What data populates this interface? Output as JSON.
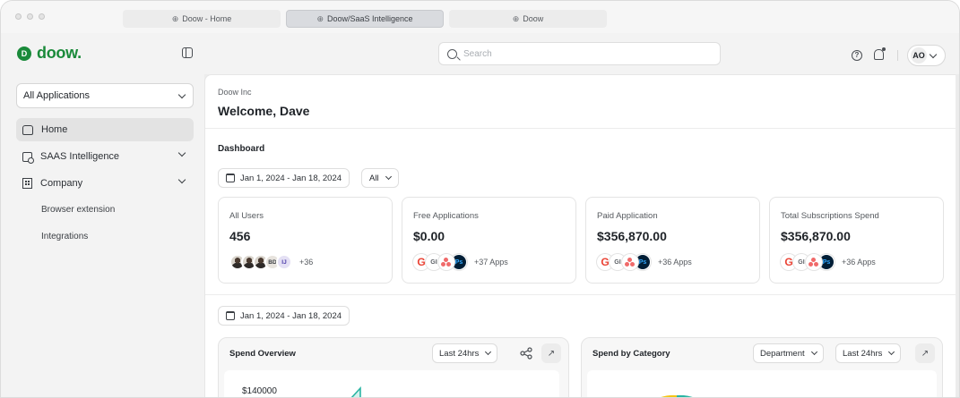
{
  "browser": {
    "tabs": [
      {
        "label": "Doow - Home"
      },
      {
        "label": "Doow/SaaS Intelligence"
      },
      {
        "label": "Doow"
      }
    ]
  },
  "header": {
    "brand": "doow.",
    "brand_mark": "D",
    "search_placeholder": "Search",
    "user_initials": "AO"
  },
  "sidebar": {
    "app_selector": "All Applications",
    "items": [
      {
        "label": "Home",
        "icon": "home-icon"
      },
      {
        "label": "SAAS Intelligence",
        "icon": "saas-icon"
      },
      {
        "label": "Company",
        "icon": "company-icon"
      }
    ],
    "sub_items": [
      "Browser extension",
      "Integrations"
    ]
  },
  "main": {
    "org_name": "Doow Inc",
    "welcome": "Welcome, Dave",
    "section_title": "Dashboard",
    "date_range": "Jan 1, 2024 - Jan 18, 2024",
    "filter": "All",
    "cards": [
      {
        "label": "All Users",
        "value": "456",
        "more": "+36",
        "badges": [
          "BD",
          "IJ"
        ]
      },
      {
        "label": "Free Applications",
        "value": "$0.00",
        "more": "+37 Apps"
      },
      {
        "label": "Paid Application",
        "value": "$356,870.00",
        "more": "+36 Apps"
      },
      {
        "label": "Total Subscriptions Spend",
        "value": "$356,870.00",
        "more": "+36 Apps"
      }
    ],
    "app_logo_labels": {
      "google": "G",
      "gi": "GI",
      "ps": "Ps"
    },
    "second_date_range": "Jan 1, 2024 - Jan 18, 2024",
    "spend_overview": {
      "title": "Spend Overview",
      "period": "Last 24hrs",
      "y_tick": "$140000"
    },
    "spend_by_category": {
      "title": "Spend by Category",
      "group": "Department",
      "period": "Last 24hrs"
    }
  },
  "colors": {
    "brand": "#1a8a3a",
    "teal": "#2bb5a3",
    "yellow": "#f5c518"
  }
}
